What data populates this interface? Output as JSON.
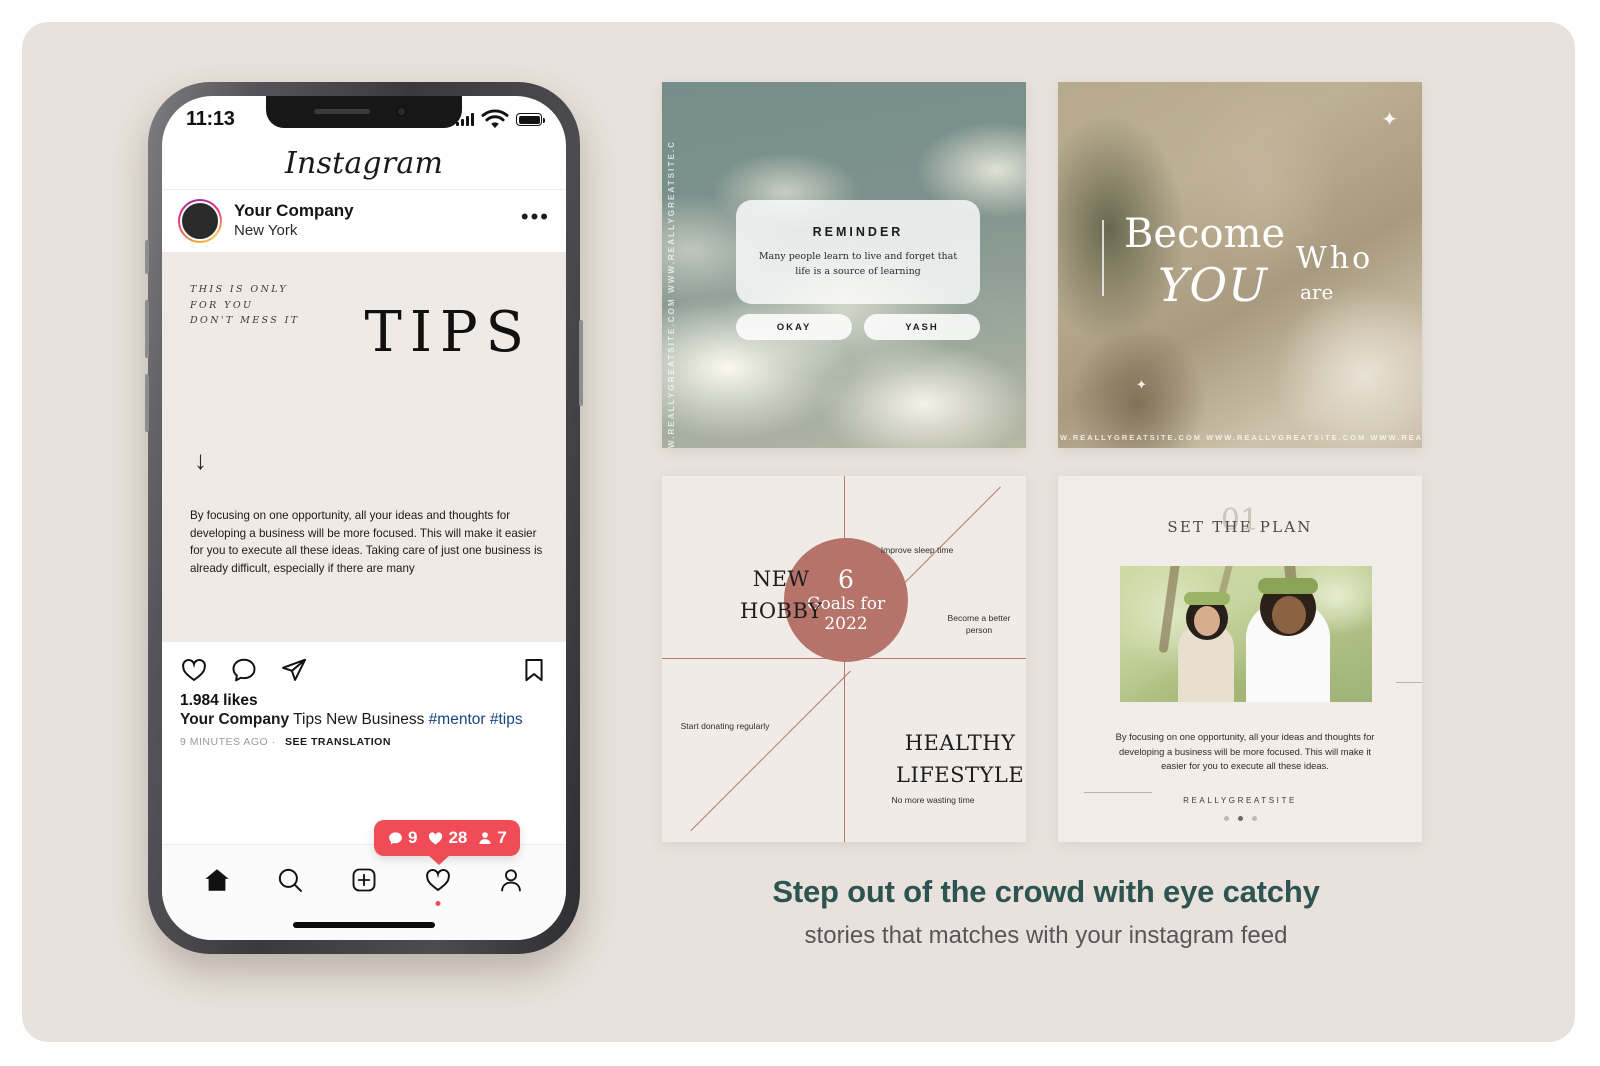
{
  "phone": {
    "status": {
      "time": "11:13",
      "signal_icon": "signal-bars-icon",
      "wifi_icon": "wifi-icon",
      "battery_icon": "battery-full-icon"
    },
    "app_title": "Instagram",
    "post_header": {
      "username": "Your Company",
      "location": "New York",
      "more_label": "•••"
    },
    "post_media": {
      "kicker_line1": "THIS IS ONLY",
      "kicker_line2": "FOR YOU",
      "kicker_line3": "DON'T MESS IT",
      "title": "TIPS",
      "arrow": "↓",
      "body": "By focusing on one opportunity, all your ideas and thoughts for developing a business will be more focused. This will make it easier for you to execute all these ideas. Taking care of just one business is already difficult, especially if there are many"
    },
    "actions": {
      "like": "heart-icon",
      "comment": "comment-icon",
      "share": "paper-plane-icon",
      "save": "bookmark-icon"
    },
    "meta": {
      "likes": "1.984 likes",
      "caption_user": "Your Company",
      "caption_text": "Tips New Business",
      "caption_tags": "#mentor #tips",
      "timestamp": "9 MINUTES AGO",
      "separator": "·",
      "translate": "SEE TRANSLATION"
    },
    "badge": {
      "comments": "9",
      "likes": "28",
      "followers": "7",
      "color": "#ef4c57"
    },
    "tabbar": {
      "home": "home-icon",
      "search": "search-icon",
      "add": "plus-square-icon",
      "activity": "heart-icon",
      "profile": "person-icon"
    }
  },
  "cards": {
    "reminder": {
      "watermark": "W.REALLYGREATSITE.COM WWW.REALLYGREATSITE.C",
      "title": "REMINDER",
      "text": "Many people learn to live and forget that life is a source of learning",
      "button_left": "OKAY",
      "button_right": "YASH"
    },
    "become": {
      "line1": "Become",
      "word_who": "Who",
      "word_you": "YOU",
      "word_are": "are",
      "watermark": "W.REALLYGREATSITE.COM WWW.REALLYGREATSITE.COM WWW.REALLYGREATSITE.C"
    },
    "goals": {
      "center_number": "6",
      "center_line1": "Goals for",
      "center_line2": "2022",
      "big_top_left_l1": "NEW",
      "big_top_left_l2": "HOBBY",
      "big_bottom_right_l1": "HEALTHY",
      "big_bottom_right_l2": "LIFESTYLE",
      "small_1": "Improve sleep time",
      "small_2": "Become a better person",
      "small_3": "Start donating regularly",
      "small_4": "No more wasting time",
      "accent_color": "#b5736a"
    },
    "plan": {
      "number": "01",
      "title": "SET THE PLAN",
      "body": "By focusing on one opportunity, all your ideas and thoughts for developing a business will be more focused. This will make it easier for you to execute all these ideas.",
      "brand": "REALLYGREATSITE"
    }
  },
  "footer": {
    "headline": "Step out of the crowd with eye catchy",
    "subline": "stories that matches with your instagram feed",
    "headline_color": "#2d5451"
  }
}
